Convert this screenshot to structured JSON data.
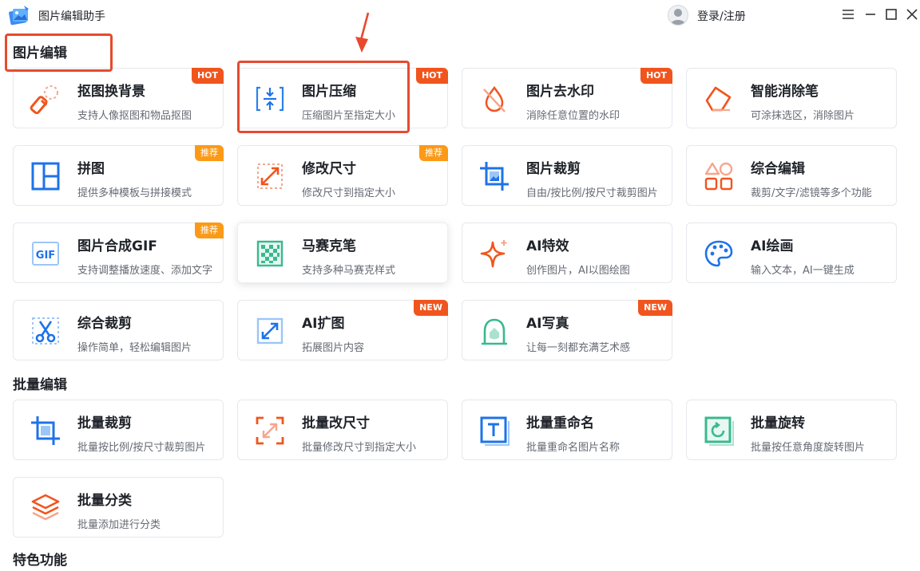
{
  "app": {
    "title": "图片编辑助手",
    "login": "登录/注册"
  },
  "sections": {
    "edit": "图片编辑",
    "batch": "批量编辑",
    "special": "特色功能"
  },
  "cards": {
    "cutout": {
      "title": "抠图换背景",
      "desc": "支持人像抠图和物品抠图",
      "badge": "HOT"
    },
    "compress": {
      "title": "图片压缩",
      "desc": "压缩图片至指定大小",
      "badge": "HOT"
    },
    "watermark": {
      "title": "图片去水印",
      "desc": "消除任意位置的水印",
      "badge": "HOT"
    },
    "eraser": {
      "title": "智能消除笔",
      "desc": "可涂抹选区，消除图片"
    },
    "collage": {
      "title": "拼图",
      "desc": "提供多种模板与拼接模式",
      "badge": "推荐"
    },
    "resize": {
      "title": "修改尺寸",
      "desc": "修改尺寸到指定大小",
      "badge": "推荐"
    },
    "crop": {
      "title": "图片裁剪",
      "desc": "自由/按比例/按尺寸裁剪图片"
    },
    "combo_edit": {
      "title": "综合编辑",
      "desc": "裁剪/文字/滤镜等多个功能"
    },
    "gif": {
      "title": "图片合成GIF",
      "desc": "支持调整播放速度、添加文字",
      "badge": "推荐",
      "icon_text": "GIF"
    },
    "mosaic": {
      "title": "马赛克笔",
      "desc": "支持多种马赛克样式"
    },
    "ai_effect": {
      "title": "AI特效",
      "desc": "创作图片，AI以图绘图"
    },
    "ai_paint": {
      "title": "AI绘画",
      "desc": "输入文本，AI一键生成"
    },
    "combo_crop": {
      "title": "综合裁剪",
      "desc": "操作简单，轻松编辑图片"
    },
    "ai_expand": {
      "title": "AI扩图",
      "desc": "拓展图片内容",
      "badge": "NEW"
    },
    "ai_portrait": {
      "title": "AI写真",
      "desc": "让每一刻都充满艺术感",
      "badge": "NEW"
    },
    "batch_crop": {
      "title": "批量裁剪",
      "desc": "批量按比例/按尺寸裁剪图片"
    },
    "batch_resize": {
      "title": "批量改尺寸",
      "desc": "批量修改尺寸到指定大小"
    },
    "batch_rename": {
      "title": "批量重命名",
      "desc": "批量重命名图片名称"
    },
    "batch_rotate": {
      "title": "批量旋转",
      "desc": "批量按任意角度旋转图片"
    },
    "batch_classify": {
      "title": "批量分类",
      "desc": "批量添加进行分类"
    }
  },
  "colors": {
    "accent_red": "#f0551e",
    "accent_blue": "#1e73e8",
    "badge_orange": "#fb9a17",
    "annotation_red": "#e84a2e"
  }
}
